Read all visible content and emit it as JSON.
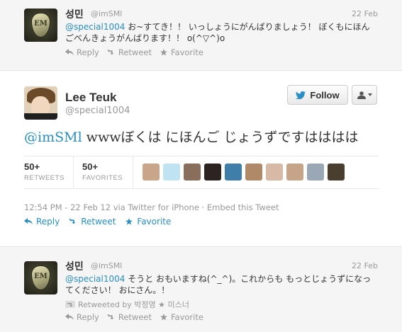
{
  "tweets": [
    {
      "name": "성민",
      "handle": "@imSMl",
      "date": "22 Feb",
      "mention": "@special1004",
      "text": " お~すてき！！ いっしょうにがんばりましょう！ ぼくもにほんごべんきょうがんばります！！ o(^▽^)o",
      "avatar_text": "EM"
    },
    {
      "name": "Lee Teuk",
      "handle": "@special1004",
      "follow_label": "Follow",
      "mention": "@imSMl",
      "text": " wwwぼくは にほんご じょうずですはははは",
      "retweets_count": "50+",
      "retweets_label": "RETWEETS",
      "favorites_count": "50+",
      "favorites_label": "FAVORITES",
      "meta": "12:54 PM - 22 Feb 12 via Twitter for iPhone · Embed this Tweet"
    },
    {
      "name": "성민",
      "handle": "@imSMl",
      "date": "22 Feb",
      "mention": "@special1004",
      "text": " そうと おもいますね(^_^)。これからも もっとじょうずになってください！ おにさん。！",
      "retweeted_by": "Retweeted by 박정영 ★ 미스너",
      "avatar_text": "EM"
    }
  ],
  "actions": {
    "reply": "Reply",
    "retweet": "Retweet",
    "favorite": "Favorite"
  },
  "favoriter_faces": [
    "#c9a68a",
    "#bfe3f0",
    "#8a6e5c",
    "#2b2420",
    "#3e7ea8",
    "#b08a68",
    "#d8b9a6",
    "#c6a487",
    "#9aa7b4",
    "#4a3f2f"
  ],
  "colors": {
    "link": "#2a8ec2",
    "muted": "#999999",
    "bg_light": "#f5f5f5"
  }
}
